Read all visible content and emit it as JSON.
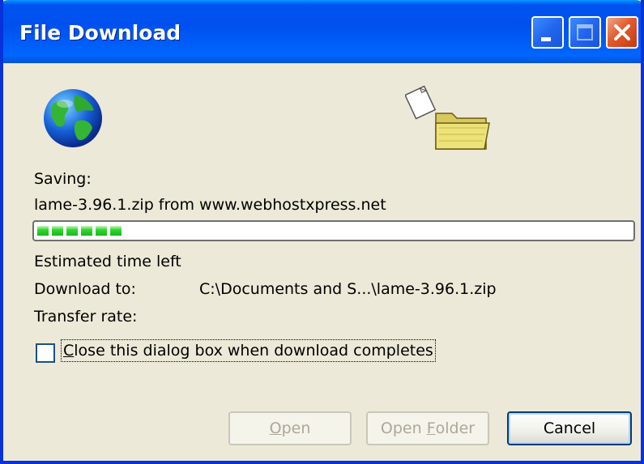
{
  "window": {
    "title": "File Download",
    "controls": {
      "minimize": "minimize-icon",
      "maximize": "maximize-icon",
      "close": "close-icon"
    }
  },
  "icons": {
    "globe": "globe-icon",
    "folder": "folder-icon"
  },
  "status": {
    "saving_label": "Saving:",
    "source_text": "lame-3.96.1.zip from www.webhostxpress.net",
    "progress_fraction": 0.14,
    "estimated_label": "Estimated time left",
    "download_to_label": "Download to:",
    "download_to_value": "C:\\Documents and S...\\lame-3.96.1.zip",
    "transfer_rate_label": "Transfer rate:"
  },
  "options": {
    "close_checkbox_label_underlined": "C",
    "close_checkbox_label_rest": "lose this dialog box when download completes",
    "close_checkbox_checked": false
  },
  "buttons": {
    "open_underlined": "O",
    "open_rest": "pen",
    "open_folder_prefix": "Open ",
    "open_folder_underlined": "F",
    "open_folder_rest": "older",
    "cancel": "Cancel"
  },
  "colors": {
    "titlebar": "#0053ee",
    "dialog_bg": "#ece9d8",
    "progress_green": "#33d633",
    "close_red": "#e25a2c"
  }
}
